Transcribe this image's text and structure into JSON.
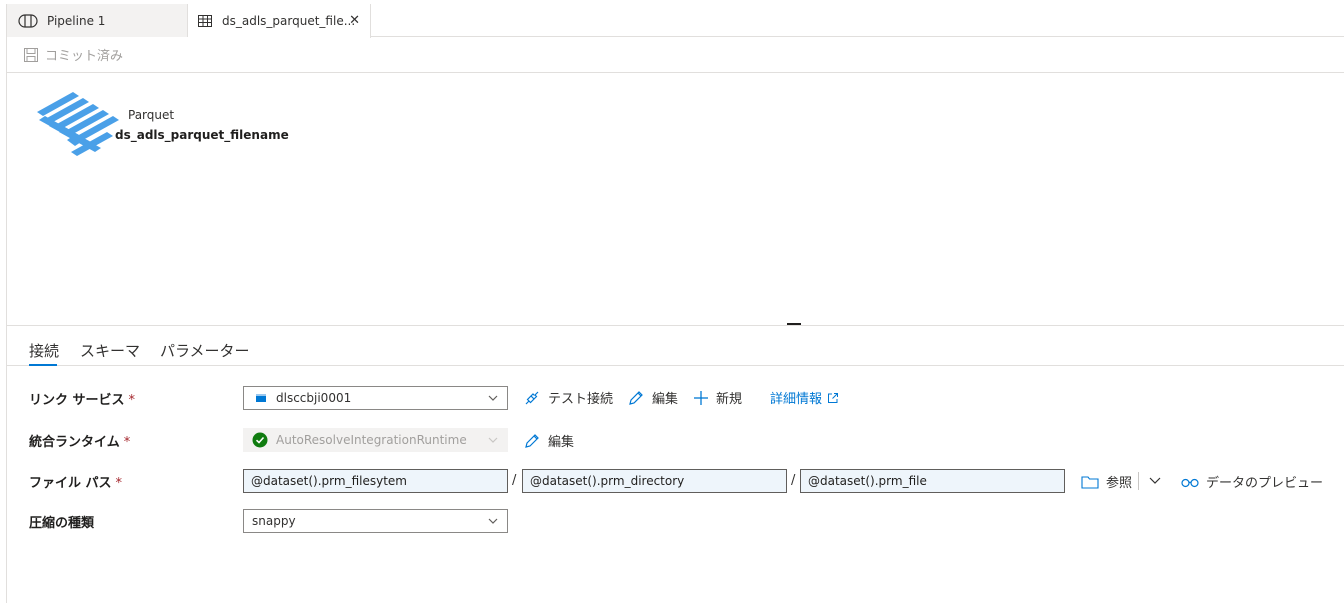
{
  "tabs": [
    {
      "label": "Pipeline 1"
    },
    {
      "label": "ds_adls_parquet_file...",
      "close": "✕"
    }
  ],
  "toolbar": {
    "commit_label": "コミット済み"
  },
  "dataset": {
    "type": "Parquet",
    "name": "ds_adls_parquet_filename"
  },
  "subtabs": [
    "接続",
    "スキーマ",
    "パラメーター"
  ],
  "form": {
    "linked_service": {
      "label": "リンク サービス",
      "required": "*",
      "value": "dlsccbji0001",
      "test_connection": "テスト接続",
      "edit": "編集",
      "new": "新規",
      "details": "詳細情報"
    },
    "integration_runtime": {
      "label": "統合ランタイム",
      "required": "*",
      "value": "AutoResolveIntegrationRuntime",
      "edit": "編集"
    },
    "file_path": {
      "label": "ファイル パス",
      "required": "*",
      "filesystem": "@dataset().prm_filesytem",
      "directory": "@dataset().prm_directory",
      "file": "@dataset().prm_file",
      "separator": "/",
      "browse": "参照",
      "preview": "データのプレビュー"
    },
    "compression": {
      "label": "圧縮の種類",
      "value": "snappy"
    }
  },
  "colors": {
    "accent": "#0078d4",
    "dataset_icon": "#4aa0e8",
    "success": "#107c10",
    "required": "#a4262c"
  }
}
